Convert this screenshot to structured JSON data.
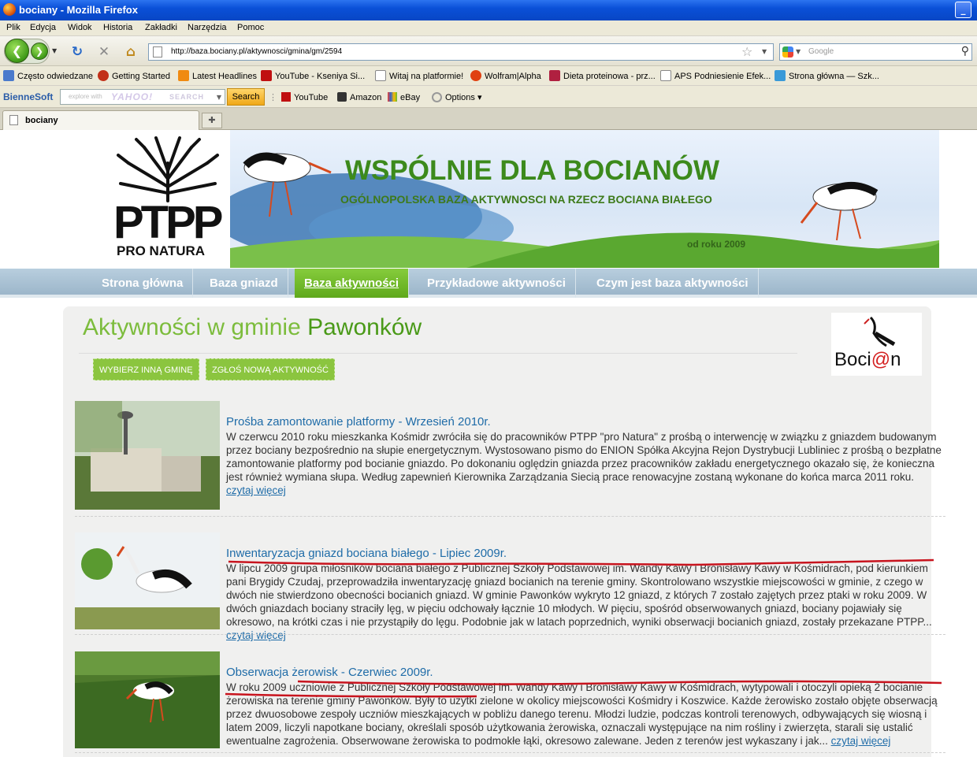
{
  "window": {
    "title": "bociany - Mozilla Firefox"
  },
  "menu": [
    "Plik",
    "Edycja",
    "Widok",
    "Historia",
    "Zakładki",
    "Narzędzia",
    "Pomoc"
  ],
  "address": {
    "url": "http://baza.bociany.pl/aktywnosci/gmina/gm/2594"
  },
  "search": {
    "placeholder": "Google"
  },
  "bookmarks": [
    "Często odwiedzane",
    "Getting Started",
    "Latest Headlines",
    "YouTube - Kseniya Si...",
    "Witaj na platformie!",
    "Wolfram|Alpha",
    "Dieta proteinowa - prz...",
    "APS Podniesienie Efek...",
    "Strona główna — Szk..."
  ],
  "toolbar": {
    "brand": "BienneSoft",
    "search_small": "explore with",
    "yahoo": "YAHOO!",
    "search_word": "SEARCH",
    "search_btn": "Search",
    "links": [
      "YouTube",
      "Amazon",
      "eBay",
      "Options"
    ]
  },
  "tab": {
    "label": "bociany"
  },
  "banner": {
    "logo_text": "PTPP",
    "logo_sub": "PRO NATURA",
    "title": "WSPÓLNIE DLA BOCIANÓW",
    "subtitle": "OGÓLNOPOLSKA BAZA AKTYWNOSCI NA RZECZ BOCIANA BIAŁEGO",
    "since": "od roku 2009"
  },
  "nav": [
    "Strona główna",
    "Baza gniazd",
    "Baza aktywności",
    "Przykładowe aktywności",
    "Czym jest baza aktywności"
  ],
  "page": {
    "heading_prefix": "Aktywności w gminie",
    "heading_place": "Pawonków",
    "btn_change": "WYBIERZ INNĄ GMINĘ",
    "btn_report": "ZGŁOŚ NOWĄ AKTYWNOŚĆ",
    "badge_text_a": "Boci",
    "badge_text_at": "@",
    "badge_text_b": "n"
  },
  "posts": [
    {
      "title": "Prośba zamontowanie platformy - Wrzesień 2010r.",
      "body": "W czerwcu 2010 roku mieszkanka Kośmidr zwróciła się do pracowników PTPP \"pro Natura\" z prośbą o interwencję w związku z gniazdem budowanym przez bociany bezpośrednio na słupie energetycznym. Wystosowano pismo do ENION Spółka Akcyjna Rejon Dystrybucji Lubliniec z prośbą o bezpłatne zamontowanie platformy pod bocianie gniazdo. Po dokonaniu oględzin gniazda przez pracowników zakładu energetycznego okazało się, że konieczna jest również wymiana słupa. Według zapewnień Kierownika Zarządzania Siecią prace renowacyjne zostaną wykonane do końca marca 2011 roku.",
      "more": "czytaj więcej"
    },
    {
      "title": "Inwentaryzacja gniazd bociana białego - Lipiec 2009r.",
      "body": "W lipcu 2009 grupa miłośników bociana białego z Publicznej Szkoły Podstawowej im. Wandy Kawy i Bronisławy Kawy w Kośmidrach, pod kierunkiem pani Brygidy Czudaj, przeprowadziła inwentaryzację gniazd bocianich na terenie gminy. Skontrolowano wszystkie miejscowości w gminie, z czego w dwóch nie stwierdzono obecności bocianich gniazd. W gminie Pawonków wykryto 12 gniazd, z których 7 zostało zajętych przez ptaki w roku 2009. W dwóch gniazdach bociany straciły lęg, w pięciu odchowały łącznie 10 młodych. W pięciu, spośród obserwowanych gniazd, bociany pojawiały się okresowo, na krótki czas i nie przystąpiły do lęgu. Podobnie jak w latach poprzednich, wyniki obserwacji bocianich gniazd, zostały przekazane PTPP...",
      "more": "czytaj więcej"
    },
    {
      "title": "Obserwacja żerowisk - Czerwiec 2009r.",
      "body": "W roku 2009 uczniowie z Publicznej Szkoły Podstawowej im. Wandy Kawy i Bronisławy Kawy w Kośmidrach, wytypowali i otoczyli opieką 2 bocianie żerowiska na terenie gminy Pawonków. Były to użytki zielone w okolicy miejscowości Kośmidry i Koszwice. Każde żerowisko zostało objęte obserwacją przez dwuosobowe zespoły uczniów mieszkających w pobliżu danego terenu. Młodzi ludzie, podczas kontroli terenowych, odbywających się wiosną i latem 2009, liczyli napotkane bociany, określali sposób użytkowania żerowiska, oznaczali występujące na nim rośliny i zwierzęta, starali się ustalić ewentualne zagrożenia. Obserwowane żerowiska to podmokłe łąki, okresowo zalewane. Jeden z terenów jest wykaszany i jak...",
      "more": "czytaj więcej"
    }
  ]
}
